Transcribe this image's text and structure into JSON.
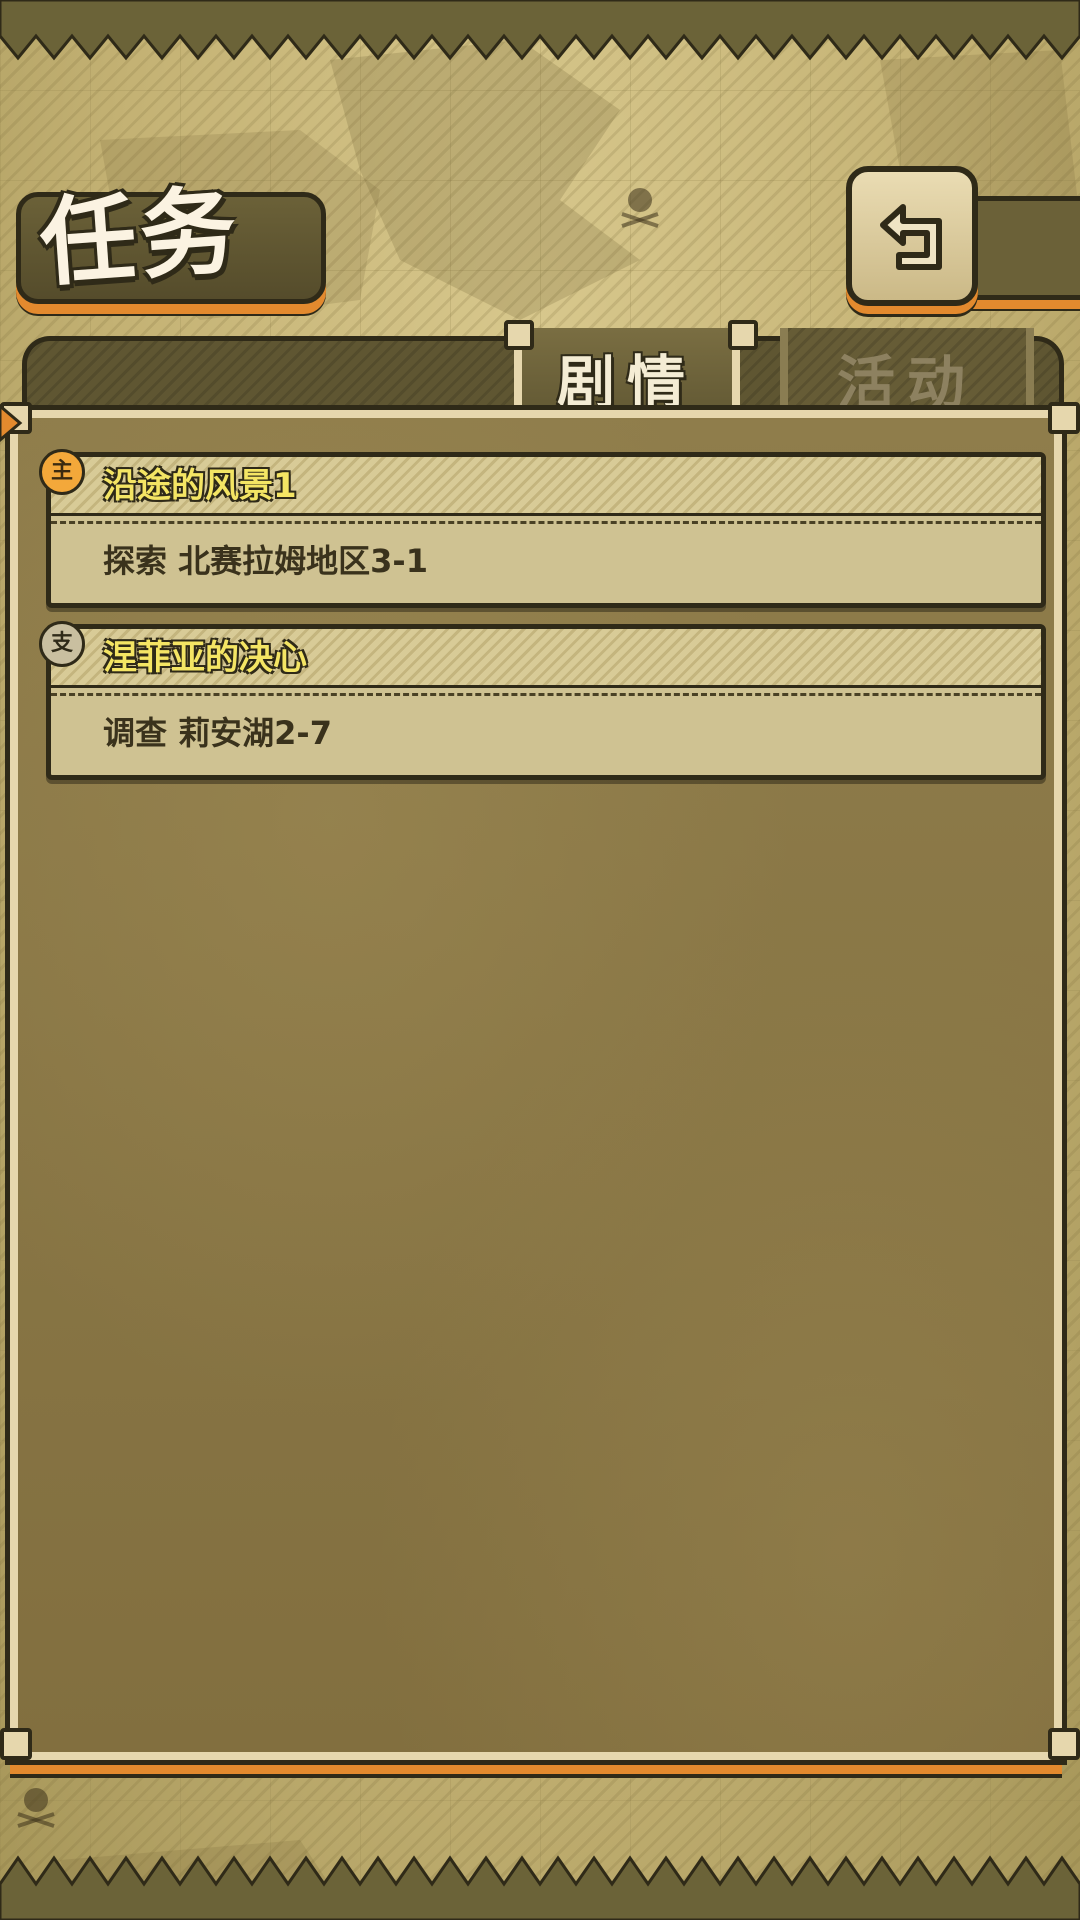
{
  "header": {
    "title": "任务"
  },
  "tabs": [
    {
      "label": "剧情",
      "active": true
    },
    {
      "label": "活动",
      "active": false
    }
  ],
  "quests": [
    {
      "type_badge": "主",
      "title": "沿途的风景1",
      "objective": "探索 北赛拉姆地区3-1"
    },
    {
      "type_badge": "支",
      "title": "涅菲亚的决心",
      "objective": "调查 莉安湖2-7"
    }
  ],
  "icons": {
    "back": "back-arrow-icon",
    "decor": "skull-icon"
  },
  "colors": {
    "accent": "#e38a2e",
    "quest_title": "#f4e564",
    "frame": "#e6d7ad",
    "outline": "#2f2a18"
  }
}
